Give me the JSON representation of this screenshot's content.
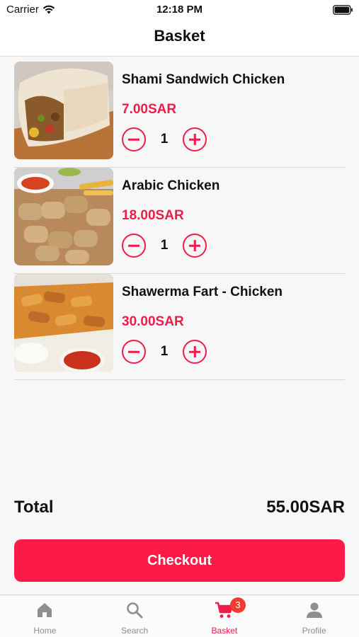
{
  "status_bar": {
    "carrier": "Carrier",
    "time": "12:18 PM"
  },
  "nav": {
    "title": "Basket"
  },
  "items": [
    {
      "name": "Shami Sandwich Chicken",
      "price": "7.00SAR",
      "quantity": "1"
    },
    {
      "name": "Arabic Chicken",
      "price": "18.00SAR",
      "quantity": "1"
    },
    {
      "name": "Shawerma Fart - Chicken",
      "price": "30.00SAR",
      "quantity": "1"
    }
  ],
  "summary": {
    "total_label": "Total",
    "total_value": "55.00SAR"
  },
  "checkout_label": "Checkout",
  "tabs": [
    {
      "label": "Home",
      "icon": "home-icon"
    },
    {
      "label": "Search",
      "icon": "search-icon"
    },
    {
      "label": "Basket",
      "icon": "cart-icon",
      "badge": "3"
    },
    {
      "label": "Profile",
      "icon": "person-icon"
    }
  ],
  "colors": {
    "accent": "#ef1c4b",
    "checkout": "#fc1a48",
    "badge": "#f23c2f"
  }
}
